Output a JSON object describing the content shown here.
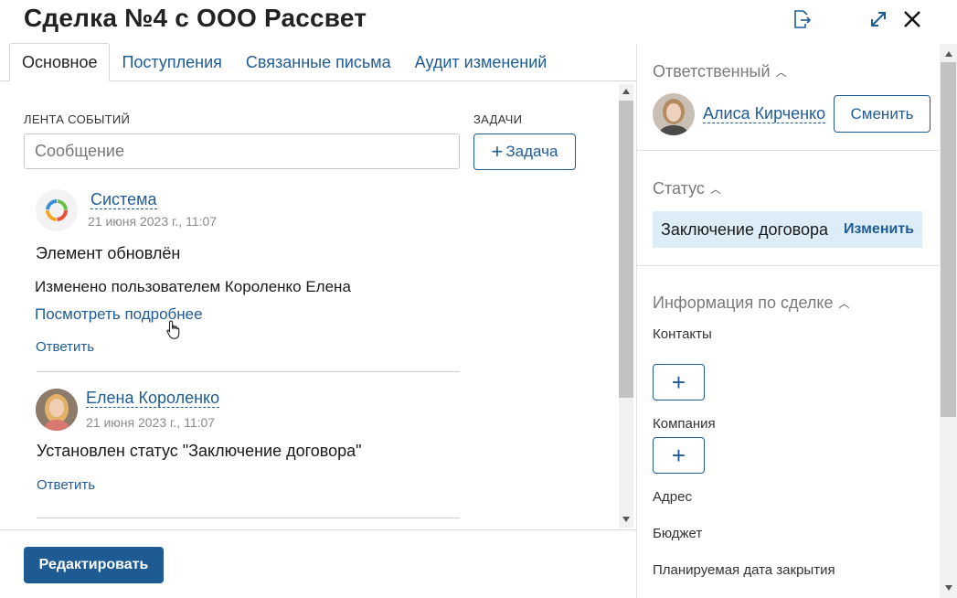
{
  "header": {
    "title": "Сделка №4 с ООО Рассвет"
  },
  "tabs": [
    {
      "label": "Основное"
    },
    {
      "label": "Поступления"
    },
    {
      "label": "Связанные письма"
    },
    {
      "label": "Аудит изменений"
    }
  ],
  "feed": {
    "label": "ЛЕНТА СОБЫТИЙ",
    "message_placeholder": "Сообщение",
    "tasks_label": "ЗАДАЧИ",
    "task_button": "Задача",
    "events": [
      {
        "author": "Система",
        "timestamp": "21 июня 2023 г., 11:07",
        "title": "Элемент обновлён",
        "text": "Изменено пользователем Короленко Елена",
        "link": "Посмотреть подробнее",
        "reply": "Ответить"
      },
      {
        "author": "Елена Короленко",
        "timestamp": "21 июня 2023 г., 11:07",
        "title": "Установлен статус \"Заключение договора\"",
        "reply": "Ответить"
      }
    ]
  },
  "footer": {
    "edit_button": "Редактировать"
  },
  "sidebar": {
    "responsible": {
      "heading": "Ответственный",
      "name": "Алиса Кирченко",
      "change_button": "Сменить"
    },
    "status": {
      "heading": "Статус",
      "value": "Заключение договора",
      "change_link": "Изменить"
    },
    "deal_info": {
      "heading": "Информация по сделке",
      "contacts_label": "Контакты",
      "company_label": "Компания",
      "address_label": "Адрес",
      "budget_label": "Бюджет",
      "close_date_label": "Планируемая дата закрытия"
    }
  },
  "colors": {
    "accent": "#1f5c96",
    "primary_button": "#1e5b93",
    "status_bg": "#dcedf8"
  }
}
